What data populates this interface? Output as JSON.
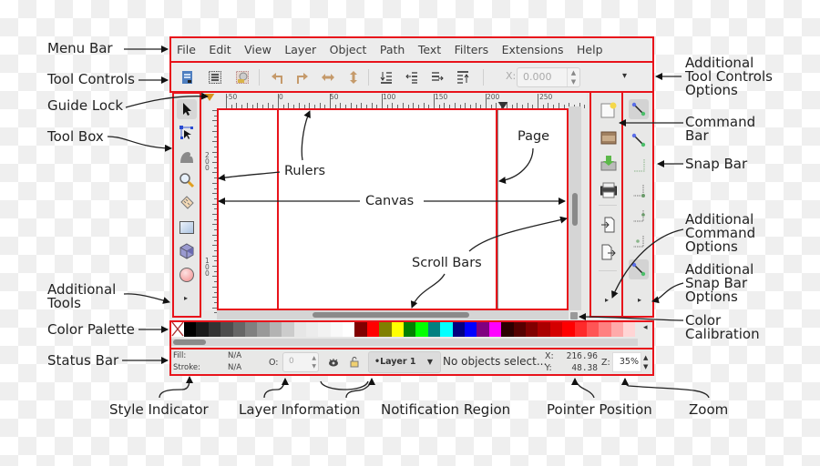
{
  "menu_bar": {
    "items": [
      "File",
      "Edit",
      "View",
      "Layer",
      "Object",
      "Path",
      "Text",
      "Filters",
      "Extensions",
      "Help"
    ]
  },
  "tool_controls": {
    "icons": [
      "select-all-icon",
      "select-all-layers-icon",
      "deselect-icon",
      "rotate-ccw-icon",
      "rotate-cw-icon",
      "flip-horizontal-icon",
      "flip-vertical-icon",
      "lower-to-bottom-icon",
      "lower-icon",
      "raise-icon",
      "raise-to-top-icon"
    ],
    "x_label": "X:",
    "x_value": "0.000",
    "more_icon": "▾"
  },
  "toolbox": {
    "tools": [
      "selector-tool",
      "node-tool",
      "tweak-tool",
      "zoom-tool",
      "measure-tool",
      "rectangle-tool",
      "3d-box-tool",
      "ellipse-tool"
    ],
    "more_icon": "▸"
  },
  "rulers": {
    "horizontal_labels": [
      "-50",
      "0",
      "50",
      "100",
      "150",
      "200",
      "250"
    ],
    "vertical_labels": [
      "200",
      "100"
    ]
  },
  "command_bar": {
    "commands": [
      "new-document",
      "open-file",
      "save-file",
      "print",
      "import",
      "export"
    ],
    "more_icon": "▸"
  },
  "snap_bar": {
    "controls": [
      "enable-snapping",
      "snap-bounding-box",
      "snap-bbox-edges",
      "snap-bbox-corners",
      "snap-bbox-edge-midpoints",
      "snap-bbox-centers",
      "snap-nodes"
    ],
    "more_icon": "▸"
  },
  "palette": {
    "colors": [
      "#000000",
      "#1a1a1a",
      "#333333",
      "#4d4d4d",
      "#666666",
      "#808080",
      "#999999",
      "#b3b3b3",
      "#cccccc",
      "#e6e6e6",
      "#ececec",
      "#f2f2f2",
      "#f9f9f9",
      "#ffffff",
      "#800000",
      "#ff0000",
      "#808000",
      "#ffff00",
      "#008000",
      "#00ff00",
      "#008080",
      "#00ffff",
      "#000080",
      "#0000ff",
      "#800080",
      "#ff00ff",
      "#2b0000",
      "#550000",
      "#800000",
      "#aa0000",
      "#d40000",
      "#ff0000",
      "#ff2a2a",
      "#ff5555",
      "#ff8080",
      "#ffaaaa",
      "#ffd5d5"
    ],
    "more_icon": "◂"
  },
  "status_bar": {
    "fill_label": "Fill:",
    "fill_value": "N/A",
    "stroke_label": "Stroke:",
    "stroke_value": "N/A",
    "opacity_label": "O:",
    "opacity_value": "0",
    "layer_name": "•Layer 1",
    "notification": "No objects select...",
    "x_label": "X:",
    "x_value": "216.96",
    "y_label": "Y:",
    "y_value": "48.38",
    "zoom_label": "Z:",
    "zoom_value": "35%"
  },
  "annotations": {
    "menu_bar": "Menu Bar",
    "tool_controls": "Tool Controls",
    "guide_lock": "Guide Lock",
    "tool_box": "Tool Box",
    "additional_tools": [
      "Additional",
      "Tools"
    ],
    "color_palette": "Color Palette",
    "status_bar": "Status Bar",
    "style_indicator": "Style Indicator",
    "layer_information": "Layer Information",
    "notification_region": "Notification Region",
    "pointer_position": "Pointer Position",
    "zoom": "Zoom",
    "additional_tool_controls_options": [
      "Additional",
      "Tool Controls",
      "Options"
    ],
    "command_bar": [
      "Command",
      "Bar"
    ],
    "snap_bar": "Snap Bar",
    "additional_command_options": [
      "Additional",
      "Command",
      "Options"
    ],
    "additional_snap_bar_options": [
      "Additional",
      "Snap Bar",
      "Options"
    ],
    "color_calibration": [
      "Color",
      "Calibration"
    ],
    "rulers": "Rulers",
    "canvas": "Canvas",
    "page": "Page",
    "scroll_bars": "Scroll Bars"
  },
  "colors": {
    "highlight": "#e8131b",
    "ui_background": "#e8e8e7"
  }
}
